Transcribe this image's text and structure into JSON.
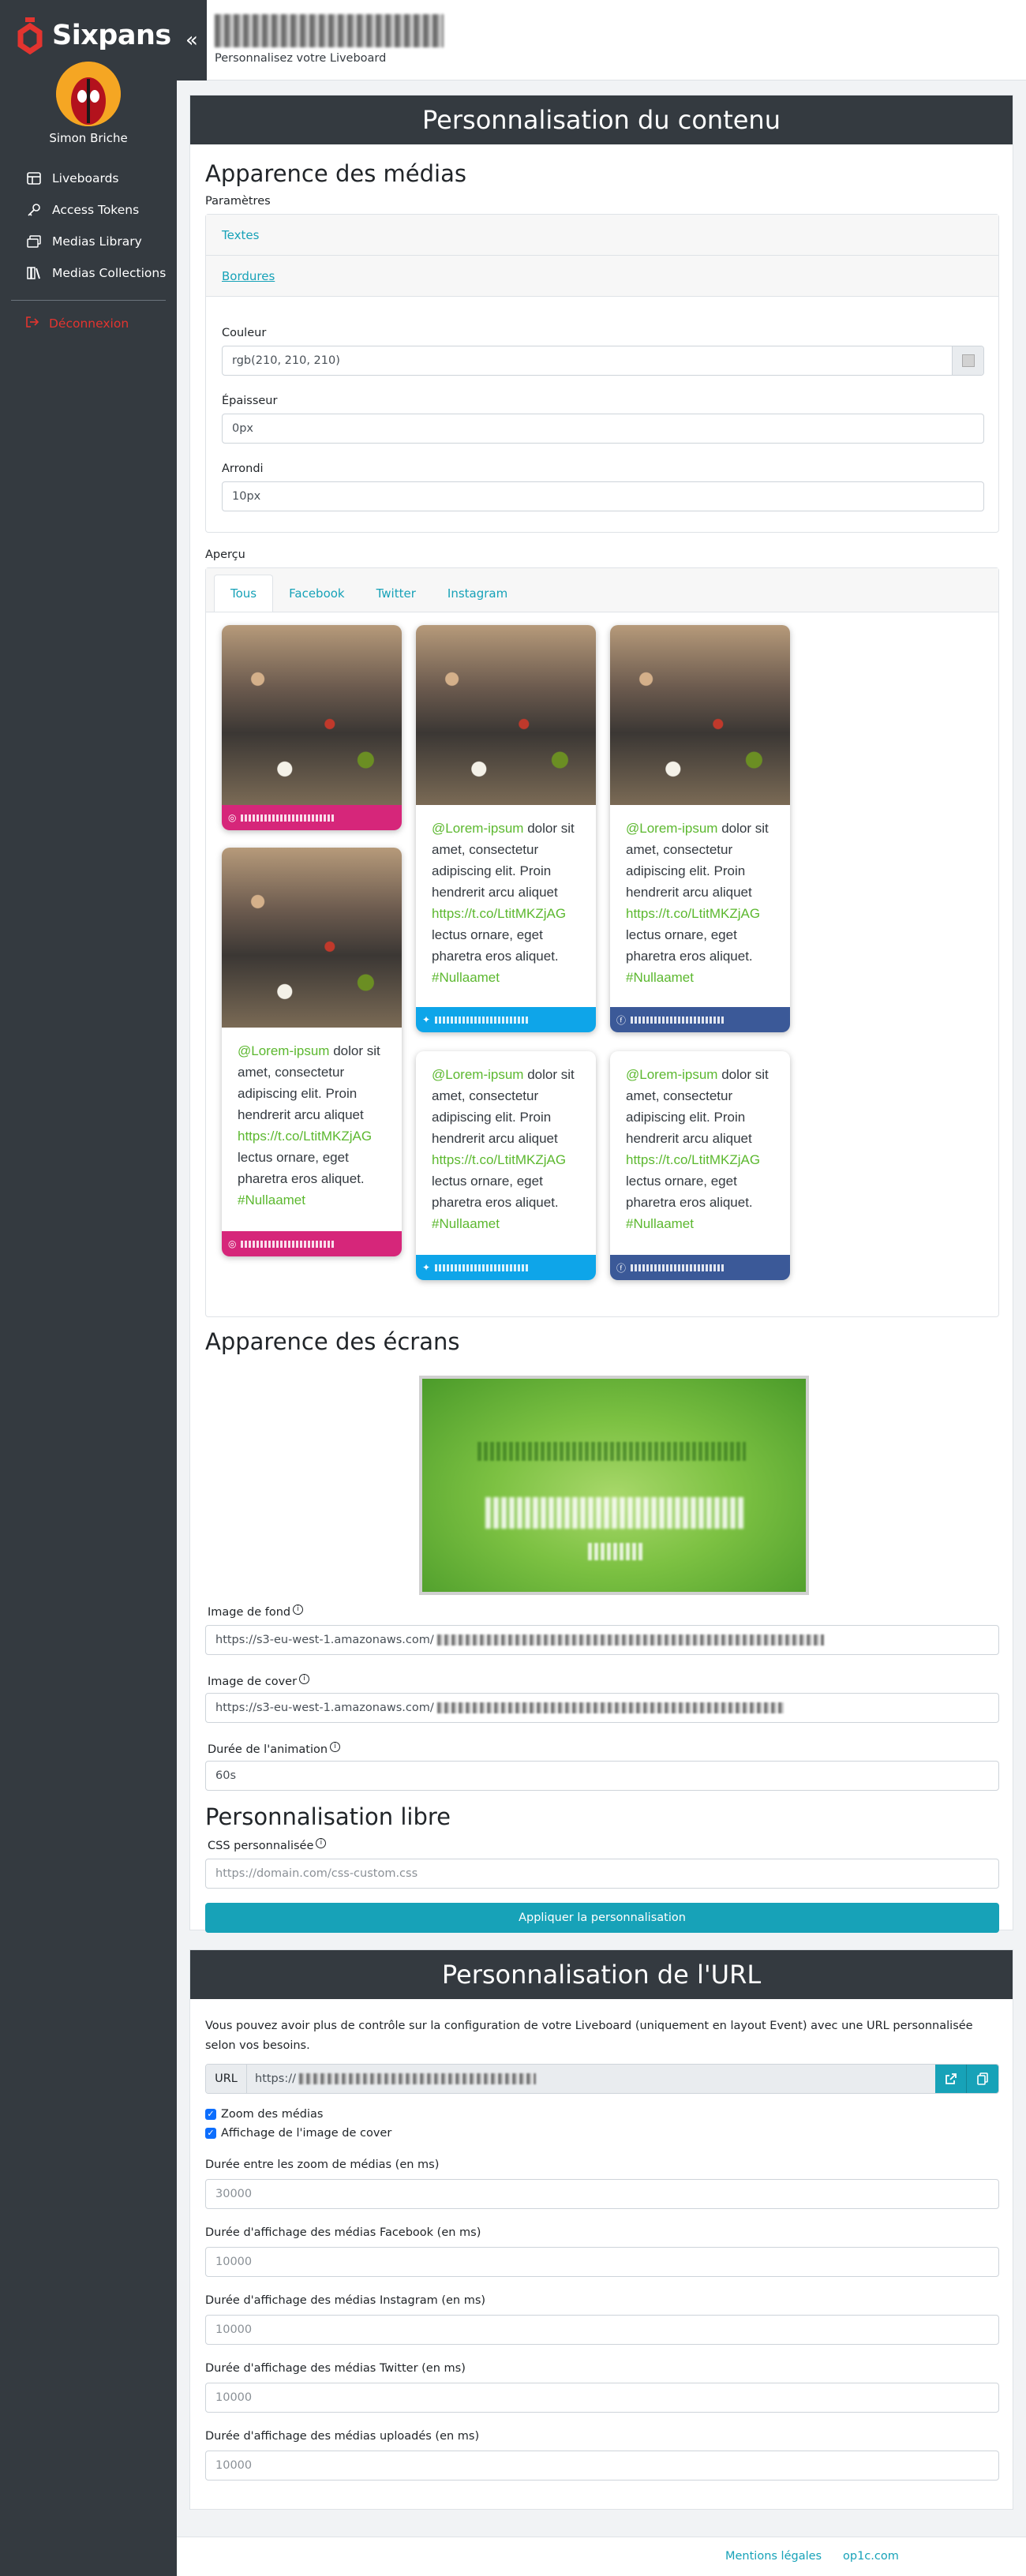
{
  "brand": {
    "name": "Sixpans",
    "accent": "#e3342f"
  },
  "sidebar": {
    "user_name": "Simon Briche",
    "items": [
      {
        "label": "Liveboards",
        "icon": "layout-icon"
      },
      {
        "label": "Access Tokens",
        "icon": "key-icon"
      },
      {
        "label": "Medias Library",
        "icon": "images-icon"
      },
      {
        "label": "Medias Collections",
        "icon": "books-icon"
      }
    ],
    "logout_label": "Déconnexion"
  },
  "header": {
    "subtitle": "Personnalisez votre Liveboard"
  },
  "content_card": {
    "title": "Personnalisation du contenu",
    "media_section": {
      "title": "Apparence des médias",
      "params_label": "Paramètres",
      "accordion": [
        "Textes",
        "Bordures"
      ],
      "color_label": "Couleur",
      "color_value": "rgb(210, 210, 210)",
      "thickness_label": "Épaisseur",
      "thickness_value": "0px",
      "radius_label": "Arrondi",
      "radius_value": "10px",
      "preview_label": "Aperçu",
      "tabs": [
        "Tous",
        "Facebook",
        "Twitter",
        "Instagram"
      ],
      "post": {
        "mention": "@Lorem-ipsum",
        "body": "dolor sit amet, consectetur adipiscing elit. Proin hendrerit arcu aliquet",
        "link": "https://t.co/LtitMKZjAG",
        "body2": "lectus ornare, eget pharetra eros aliquet.",
        "hashtag": "#Nullaamet"
      }
    },
    "screen_section": {
      "title": "Apparence des écrans",
      "bg_label": "Image de fond",
      "bg_value": "https://s3-eu-west-1.amazonaws.com/",
      "cover_label": "Image de cover",
      "cover_value": "https://s3-eu-west-1.amazonaws.com/",
      "duration_label": "Durée de l'animation",
      "duration_value": "60s"
    },
    "free_section": {
      "title": "Personnalisation libre",
      "css_label": "CSS personnalisée",
      "css_placeholder": "https://domain.com/css-custom.css",
      "apply_label": "Appliquer la personnalisation"
    }
  },
  "url_card": {
    "title": "Personnalisation de l'URL",
    "intro": "Vous pouvez avoir plus de contrôle sur la configuration de votre Liveboard (uniquement en layout Event) avec une URL personnalisée selon vos besoins.",
    "url_label": "URL",
    "url_value": "https://",
    "checkboxes": [
      "Zoom des médias",
      "Affichage de l'image de cover"
    ],
    "fields": [
      {
        "label": "Durée entre les zoom de médias (en ms)",
        "placeholder": "30000"
      },
      {
        "label": "Durée d'affichage des médias Facebook (en ms)",
        "placeholder": "10000"
      },
      {
        "label": "Durée d'affichage des médias Instagram (en ms)",
        "placeholder": "10000"
      },
      {
        "label": "Durée d'affichage des médias Twitter (en ms)",
        "placeholder": "10000"
      },
      {
        "label": "Durée d'affichage des médias uploadés (en ms)",
        "placeholder": "10000"
      }
    ]
  },
  "footer": {
    "links": [
      "Mentions légales",
      "op1c.com"
    ]
  }
}
